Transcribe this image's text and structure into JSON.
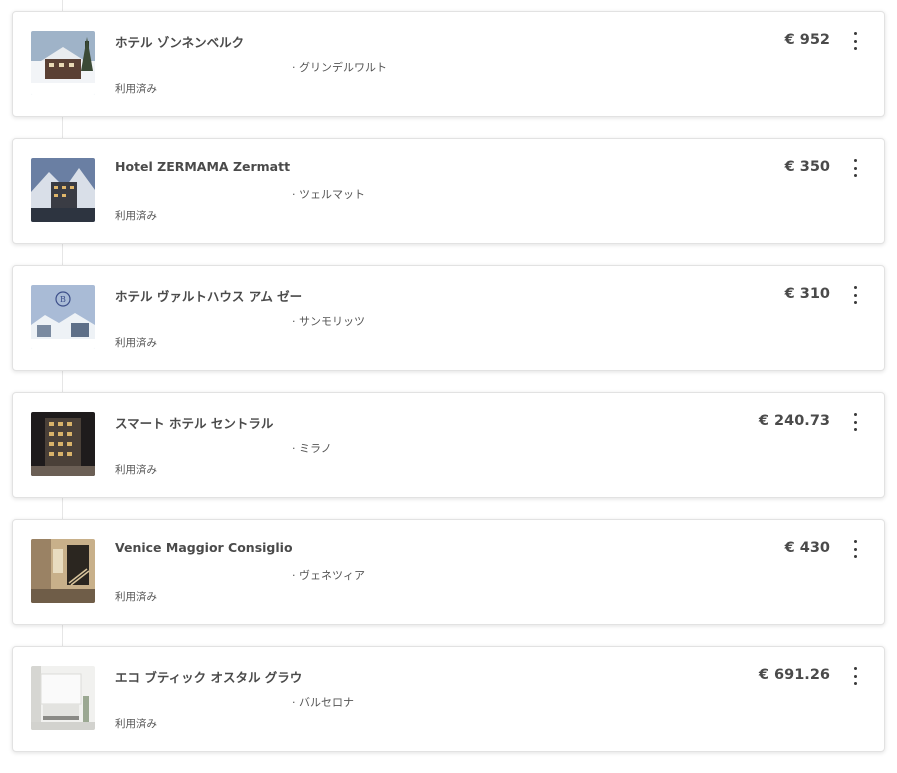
{
  "hotels": [
    {
      "name": "ホテル ゾンネンベルク",
      "city": "· グリンデルワルト",
      "status": "利用済み",
      "price": "€ 952",
      "image": "chalet-snow"
    },
    {
      "name": "Hotel ZERMAMA Zermatt",
      "city": "· ツェルマット",
      "status": "利用済み",
      "price": "€ 350",
      "image": "mountain-hotel"
    },
    {
      "name": "ホテル ヴァルトハウス アム ゼー",
      "city": "· サンモリッツ",
      "status": "利用済み",
      "price": "€ 310",
      "image": "snowy-village-logo"
    },
    {
      "name": "スマート ホテル セントラル",
      "city": "· ミラノ",
      "status": "利用済み",
      "price": "€ 240.73",
      "image": "night-building"
    },
    {
      "name": "Venice Maggior Consiglio",
      "city": "· ヴェネツィア",
      "status": "利用済み",
      "price": "€ 430",
      "image": "hotel-interior-stairs"
    },
    {
      "name": "エコ ブティック オスタル グラウ",
      "city": "· バルセロナ",
      "status": "利用済み",
      "price": "€ 691.26",
      "image": "white-bedroom"
    }
  ]
}
